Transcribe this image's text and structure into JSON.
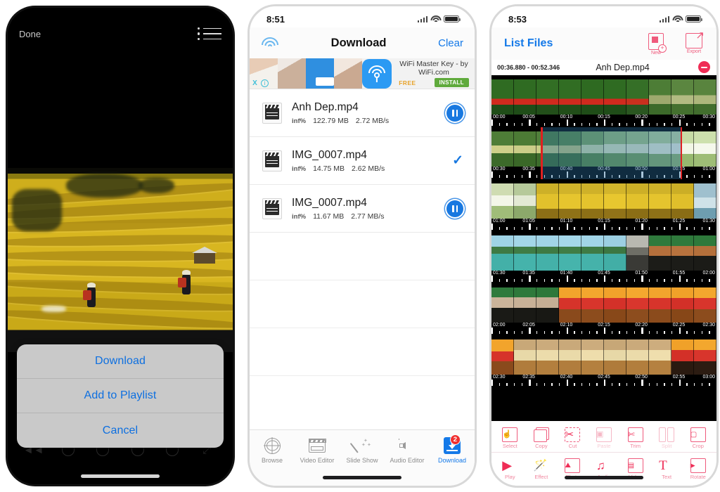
{
  "phone1": {
    "statusbar": {
      "visible": false
    },
    "topbar": {
      "done_label": "Done",
      "list_icon": "playlist-icon"
    },
    "action_sheet": {
      "items": [
        {
          "label": "Download",
          "name": "download"
        },
        {
          "label": "Add to Playlist",
          "name": "add-to-playlist"
        },
        {
          "label": "Cancel",
          "name": "cancel"
        }
      ]
    },
    "player": {
      "controls": [
        "rewind-icon",
        "prev-icon",
        "play-icon",
        "next-icon",
        "forward-icon",
        "expand-icon"
      ]
    },
    "accent_blue": "#0d6fe0",
    "sheet_bg": "#c9c9c9"
  },
  "phone2": {
    "statusbar": {
      "time": "8:51",
      "signal": "signal-icon",
      "wifi": "wifi-icon",
      "battery": "battery-icon"
    },
    "navbar": {
      "left_icon": "wifi-icon",
      "title": "Download",
      "right_label": "Clear"
    },
    "ad": {
      "title": "WiFi Master Key - by WiFi.com",
      "price_label": "FREE",
      "cta_label": "INSTALL",
      "close_label": "X",
      "info_label": "i",
      "app_icon": "wifi-key-icon"
    },
    "downloads": [
      {
        "name": "Anh Dep.mp4",
        "percent": "inf%",
        "size": "122.79 MB",
        "speed": "2.72 MB/s",
        "status": "pause",
        "icon": "movie-file-icon"
      },
      {
        "name": "IMG_0007.mp4",
        "percent": "inf%",
        "size": "14.75 MB",
        "speed": "2.62 MB/s",
        "status": "done",
        "icon": "movie-file-icon"
      },
      {
        "name": "IMG_0007.mp4",
        "percent": "inf%",
        "size": "11.67 MB",
        "speed": "2.77 MB/s",
        "status": "pause",
        "icon": "movie-file-icon"
      }
    ],
    "tabs": [
      {
        "label": "Browse",
        "icon": "globe-icon",
        "active": false
      },
      {
        "label": "Video Editor",
        "icon": "clapperboard-icon",
        "active": false
      },
      {
        "label": "Slide Show",
        "icon": "magic-wand-icon",
        "active": false
      },
      {
        "label": "Audio Editor",
        "icon": "speaker-icon",
        "active": false
      },
      {
        "label": "Download",
        "icon": "download-icon",
        "active": true,
        "badge": "2"
      }
    ],
    "accent_blue": "#1479e8",
    "badge_color": "#f03030"
  },
  "phone3": {
    "statusbar": {
      "time": "8:53",
      "signal": "signal-icon",
      "wifi": "wifi-icon",
      "battery": "battery-icon"
    },
    "navbar": {
      "title": "List Files",
      "actions": [
        {
          "label": "New",
          "icon": "new-document-icon"
        },
        {
          "label": "Export",
          "icon": "export-share-icon"
        }
      ]
    },
    "filebar": {
      "range": "00:36.880 - 00:52.346",
      "filename": "Anh Dep.mp4",
      "remove_icon": "minus-circle-icon"
    },
    "timeline": {
      "selection_start": "00:36.880",
      "selection_end": "00:52.346",
      "marker_color": "#e02020",
      "rows": [
        {
          "labels": [
            "00:00",
            "00:05",
            "00:10",
            "00:15",
            "00:20",
            "00:25",
            "00:30"
          ],
          "theme": "green-field"
        },
        {
          "labels": [
            "00:30",
            "00:35",
            "00:40",
            "00:45",
            "00:50",
            "00:55",
            "01:00"
          ],
          "theme": "green-blue"
        },
        {
          "labels": [
            "01:00",
            "01:05",
            "01:10",
            "01:15",
            "01:20",
            "01:25",
            "01:30"
          ],
          "theme": "yellow-terrace"
        },
        {
          "labels": [
            "01:30",
            "01:35",
            "01:40",
            "01:45",
            "01:50",
            "01:55",
            "02:00"
          ],
          "theme": "river-blue"
        },
        {
          "labels": [
            "02:00",
            "02:05",
            "02:10",
            "02:15",
            "02:20",
            "02:25",
            "02:30"
          ],
          "theme": "orange-boat"
        },
        {
          "labels": [
            "02:30",
            "02:35",
            "02:40",
            "02:45",
            "02:50",
            "02:55",
            "03:00"
          ],
          "theme": "warm-market"
        }
      ]
    },
    "tools_row1": [
      {
        "label": "Select",
        "icon": "select-icon",
        "enabled": true
      },
      {
        "label": "Copy",
        "icon": "copy-icon",
        "enabled": true
      },
      {
        "label": "Cut",
        "icon": "scissors-icon",
        "enabled": true
      },
      {
        "label": "Paste",
        "icon": "clipboard-icon",
        "enabled": false
      },
      {
        "label": "Trim",
        "icon": "trim-icon",
        "enabled": true
      },
      {
        "label": "Split",
        "icon": "split-icon",
        "enabled": false
      },
      {
        "label": "Crop",
        "icon": "crop-icon",
        "enabled": true
      }
    ],
    "tools_row2": [
      {
        "label": "Play",
        "icon": "play-icon",
        "enabled": true
      },
      {
        "label": "Effect",
        "icon": "magic-wand-icon",
        "enabled": true
      },
      {
        "label": "Photo",
        "icon": "photo-icon",
        "enabled": true
      },
      {
        "label": "Audio",
        "icon": "music-note-icon",
        "enabled": true
      },
      {
        "label": "Video",
        "icon": "filmstrip-icon",
        "enabled": true
      },
      {
        "label": "Text",
        "icon": "text-icon",
        "enabled": true
      },
      {
        "label": "Rotate",
        "icon": "rotate-icon",
        "enabled": true
      }
    ],
    "accent_pink": "#ef2d56"
  }
}
